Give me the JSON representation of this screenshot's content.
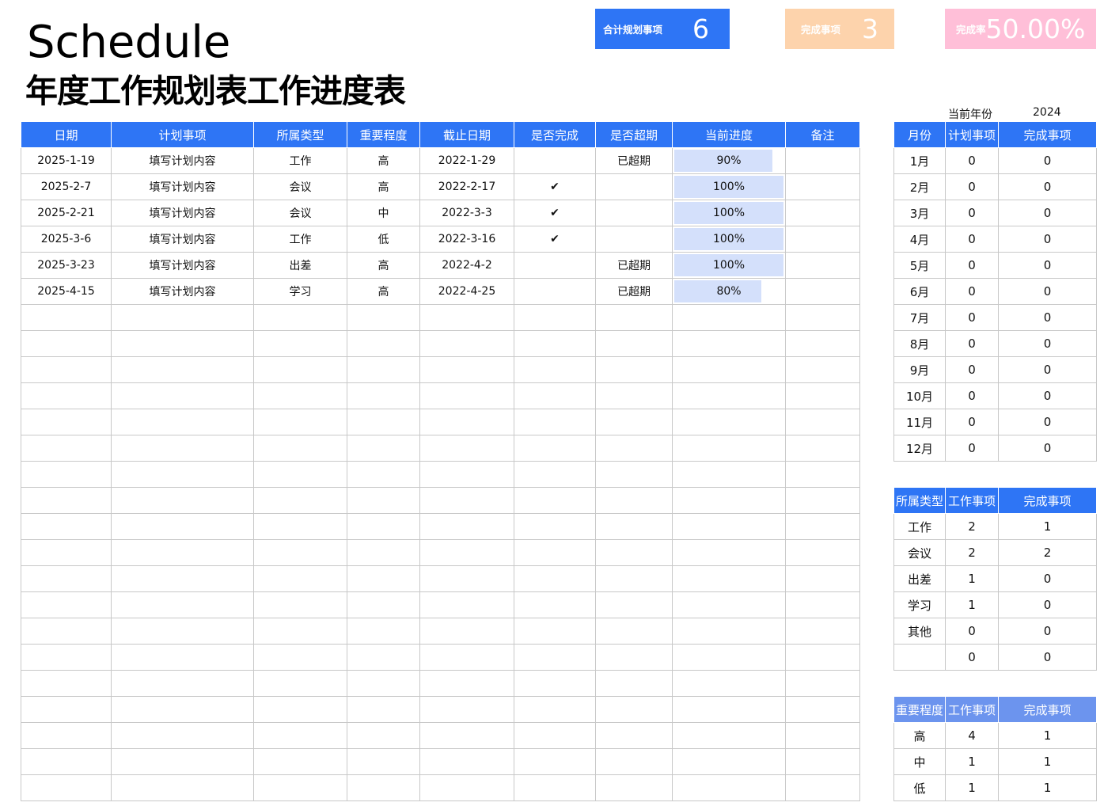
{
  "title": {
    "en": "Schedule",
    "cn": "年度工作规划表工作进度表"
  },
  "kpis": {
    "total_label": "合计规划事项",
    "total_value": "6",
    "done_label": "完成事项",
    "done_value": "3",
    "rate_label": "完成率",
    "rate_value": "50.00%"
  },
  "colors": {
    "header_blue": "#2e75f5",
    "progress_bar": "#d4e0fb",
    "done_card": "#fdd3ac",
    "rate_card": "#ffbfd8",
    "importance_header": "#6c94ee"
  },
  "main_table": {
    "headers": [
      "日期",
      "计划事项",
      "所属类型",
      "重要程度",
      "截止日期",
      "是否完成",
      "是否超期",
      "当前进度",
      "备注"
    ],
    "rows": [
      {
        "date": "2025-1-19",
        "item": "填写计划内容",
        "type": "工作",
        "importance": "高",
        "deadline": "2022-1-29",
        "done": "",
        "overdue": "已超期",
        "progress": 0.9,
        "progress_text": "90%",
        "note": ""
      },
      {
        "date": "2025-2-7",
        "item": "填写计划内容",
        "type": "会议",
        "importance": "高",
        "deadline": "2022-2-17",
        "done": "✔",
        "overdue": "",
        "progress": 1.0,
        "progress_text": "100%",
        "note": ""
      },
      {
        "date": "2025-2-21",
        "item": "填写计划内容",
        "type": "会议",
        "importance": "中",
        "deadline": "2022-3-3",
        "done": "✔",
        "overdue": "",
        "progress": 1.0,
        "progress_text": "100%",
        "note": ""
      },
      {
        "date": "2025-3-6",
        "item": "填写计划内容",
        "type": "工作",
        "importance": "低",
        "deadline": "2022-3-16",
        "done": "✔",
        "overdue": "",
        "progress": 1.0,
        "progress_text": "100%",
        "note": ""
      },
      {
        "date": "2025-3-23",
        "item": "填写计划内容",
        "type": "出差",
        "importance": "高",
        "deadline": "2022-4-2",
        "done": "",
        "overdue": "已超期",
        "progress": 1.0,
        "progress_text": "100%",
        "note": ""
      },
      {
        "date": "2025-4-15",
        "item": "填写计划内容",
        "type": "学习",
        "importance": "高",
        "deadline": "2022-4-25",
        "done": "",
        "overdue": "已超期",
        "progress": 0.8,
        "progress_text": "80%",
        "note": ""
      }
    ],
    "empty_rows": 19
  },
  "year": {
    "label": "当前年份",
    "value": "2024"
  },
  "monthly": {
    "headers": [
      "月份",
      "计划事项",
      "完成事项"
    ],
    "rows": [
      [
        "1月",
        "0",
        "0"
      ],
      [
        "2月",
        "0",
        "0"
      ],
      [
        "3月",
        "0",
        "0"
      ],
      [
        "4月",
        "0",
        "0"
      ],
      [
        "5月",
        "0",
        "0"
      ],
      [
        "6月",
        "0",
        "0"
      ],
      [
        "7月",
        "0",
        "0"
      ],
      [
        "8月",
        "0",
        "0"
      ],
      [
        "9月",
        "0",
        "0"
      ],
      [
        "10月",
        "0",
        "0"
      ],
      [
        "11月",
        "0",
        "0"
      ],
      [
        "12月",
        "0",
        "0"
      ]
    ]
  },
  "by_type": {
    "headers": [
      "所属类型",
      "工作事项",
      "完成事项"
    ],
    "rows": [
      [
        "工作",
        "2",
        "1"
      ],
      [
        "会议",
        "2",
        "2"
      ],
      [
        "出差",
        "1",
        "0"
      ],
      [
        "学习",
        "1",
        "0"
      ],
      [
        "其他",
        "0",
        "0"
      ],
      [
        "",
        "0",
        "0"
      ]
    ]
  },
  "by_importance": {
    "headers": [
      "重要程度",
      "工作事项",
      "完成事项"
    ],
    "rows": [
      [
        "高",
        "4",
        "1"
      ],
      [
        "中",
        "1",
        "1"
      ],
      [
        "低",
        "1",
        "1"
      ]
    ]
  }
}
